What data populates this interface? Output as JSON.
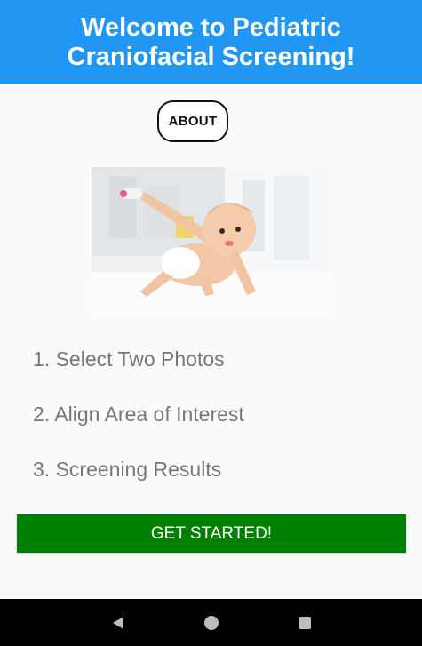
{
  "header": {
    "title": "Welcome to Pediatric Craniofacial Screening!",
    "color": "#2196f3"
  },
  "about_button": {
    "label": "ABOUT"
  },
  "hero_image": {
    "subject": "baby-crawling-photo"
  },
  "steps": [
    "1. Select Two Photos",
    "2. Align Area of Interest",
    "3. Screening Results"
  ],
  "start_button": {
    "label": "GET STARTED!",
    "color": "#008000"
  },
  "nav_bar": {
    "icons": [
      "back-icon",
      "home-icon",
      "recents-icon"
    ]
  }
}
